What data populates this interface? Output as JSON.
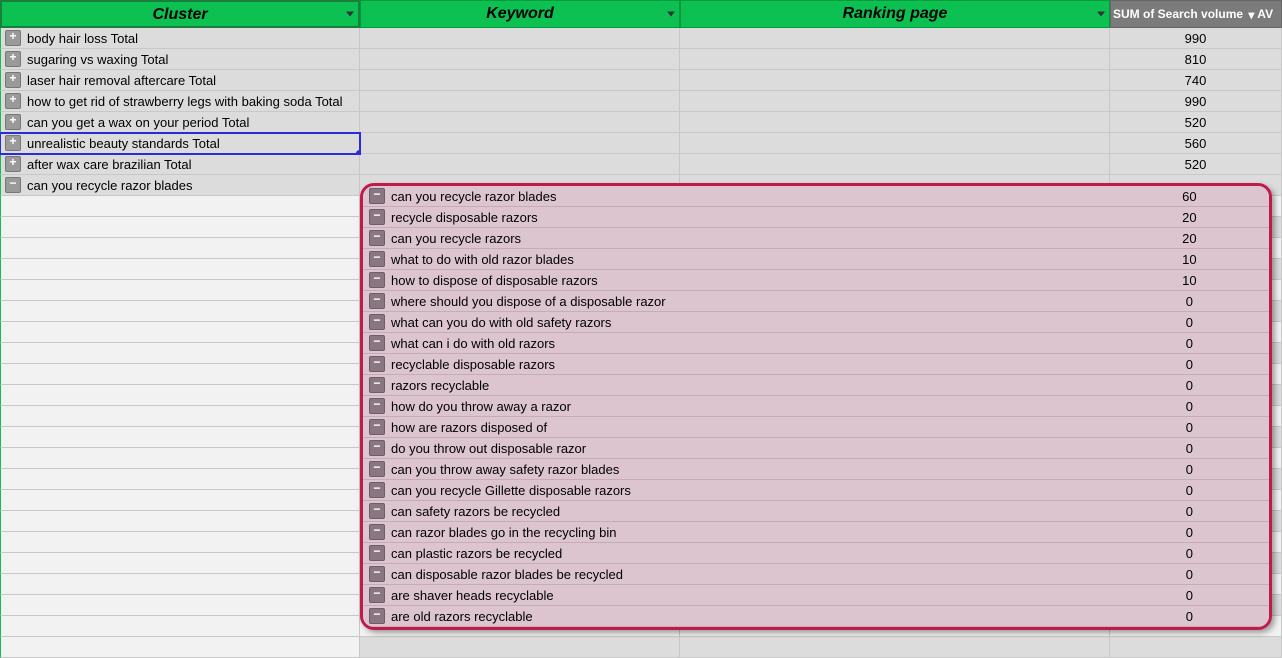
{
  "headers": {
    "cluster": "Cluster",
    "keyword": "Keyword",
    "ranking": "Ranking page",
    "sum": "SUM of Search volume",
    "av": "AV"
  },
  "clusters": [
    {
      "label": "body hair loss Total",
      "value": 990,
      "expandable": true
    },
    {
      "label": "sugaring vs waxing Total",
      "value": 810,
      "expandable": true
    },
    {
      "label": "laser hair removal aftercare Total",
      "value": 740,
      "expandable": true
    },
    {
      "label": "how to get rid of strawberry legs with baking soda Total",
      "value": 990,
      "expandable": true
    },
    {
      "label": "can you get a wax on your period Total",
      "value": 520,
      "expandable": true
    },
    {
      "label": "unrealistic beauty standards Total",
      "value": 560,
      "expandable": true,
      "selected": true
    },
    {
      "label": "after wax care brazilian Total",
      "value": 520,
      "expandable": true
    },
    {
      "label": "can you recycle razor blades",
      "value": "",
      "expandable": false
    }
  ],
  "callout_rows": [
    {
      "keyword": "can you recycle razor blades",
      "value": 60
    },
    {
      "keyword": "recycle disposable razors",
      "value": 20
    },
    {
      "keyword": "can you recycle razors",
      "value": 20
    },
    {
      "keyword": "what to do with old razor blades",
      "value": 10
    },
    {
      "keyword": "how to dispose of disposable razors",
      "value": 10
    },
    {
      "keyword": "where should you dispose of a disposable razor",
      "value": 0
    },
    {
      "keyword": "what can you do with old safety razors",
      "value": 0
    },
    {
      "keyword": "what can i do with old razors",
      "value": 0
    },
    {
      "keyword": "recyclable disposable razors",
      "value": 0
    },
    {
      "keyword": "razors recyclable",
      "value": 0
    },
    {
      "keyword": "how do you throw away a razor",
      "value": 0
    },
    {
      "keyword": "how are razors disposed of",
      "value": 0
    },
    {
      "keyword": "do you throw out disposable razor",
      "value": 0
    },
    {
      "keyword": "can you throw away safety razor blades",
      "value": 0
    },
    {
      "keyword": "can you recycle Gillette disposable razors",
      "value": 0
    },
    {
      "keyword": "can safety razors be recycled",
      "value": 0
    },
    {
      "keyword": "can razor blades go in the recycling bin",
      "value": 0
    },
    {
      "keyword": "can plastic razors be recycled",
      "value": 0
    },
    {
      "keyword": "can disposable razor blades be recycled",
      "value": 0
    },
    {
      "keyword": "are shaver heads recyclable",
      "value": 0
    },
    {
      "keyword": "are old razors recyclable",
      "value": 0
    }
  ]
}
